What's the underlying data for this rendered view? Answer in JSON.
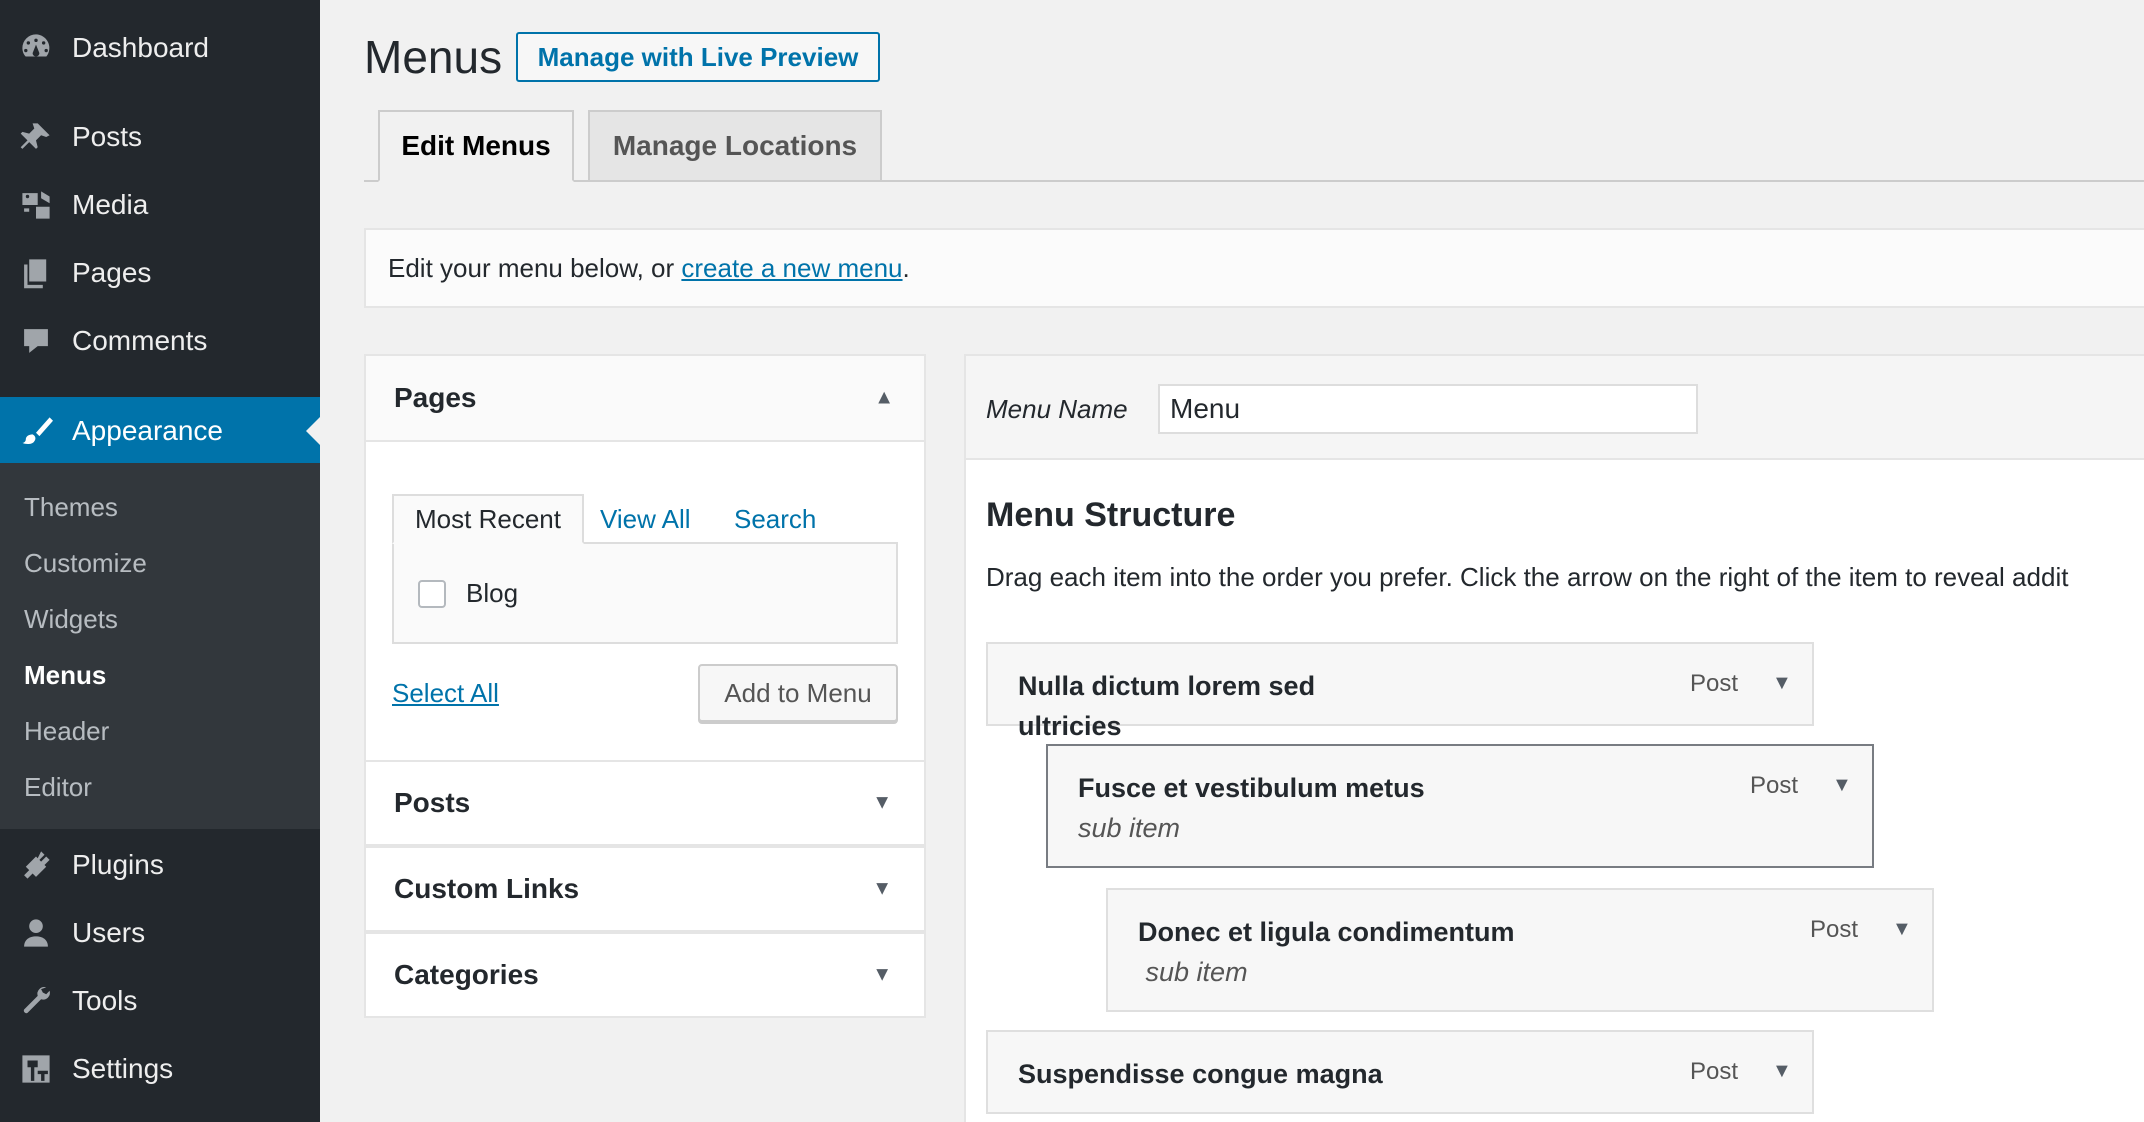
{
  "sidebar": {
    "items": [
      {
        "label": "Dashboard",
        "icon": "dashboard-icon"
      },
      {
        "label": "Posts",
        "icon": "pin-icon"
      },
      {
        "label": "Media",
        "icon": "media-icon"
      },
      {
        "label": "Pages",
        "icon": "pages-icon"
      },
      {
        "label": "Comments",
        "icon": "comment-icon"
      },
      {
        "label": "Appearance",
        "icon": "paintbrush-icon"
      },
      {
        "label": "Plugins",
        "icon": "plugin-icon"
      },
      {
        "label": "Users",
        "icon": "user-icon"
      },
      {
        "label": "Tools",
        "icon": "wrench-icon"
      },
      {
        "label": "Settings",
        "icon": "settings-icon"
      }
    ],
    "submenu": [
      "Themes",
      "Customize",
      "Widgets",
      "Menus",
      "Header",
      "Editor"
    ],
    "active_item": "Appearance",
    "current_submenu": "Menus"
  },
  "header": {
    "title": "Menus",
    "live_preview_label": "Manage with Live Preview"
  },
  "tabs": {
    "edit": "Edit Menus",
    "manage": "Manage Locations"
  },
  "notice": {
    "prefix": "Edit your menu below, or ",
    "link": "create a new menu",
    "suffix": "."
  },
  "left": {
    "pages_title": "Pages",
    "inner_tabs": {
      "recent": "Most Recent",
      "view_all": "View All",
      "search": "Search"
    },
    "page_options": [
      {
        "label": "Blog",
        "checked": false
      }
    ],
    "select_all": "Select All",
    "add_button": "Add to Menu",
    "sections": [
      "Posts",
      "Custom Links",
      "Categories"
    ]
  },
  "right": {
    "menu_name_label": "Menu Name",
    "menu_name_value": "Menu",
    "structure_title": "Menu Structure",
    "structure_desc": "Drag each item into the order you prefer. Click the arrow on the right of the item to reveal addit",
    "items": [
      {
        "title": "Nulla dictum lorem sed ultricies",
        "sub": "",
        "type": "Post"
      },
      {
        "title": "Fusce et vestibulum metus",
        "sub": "sub item",
        "type": "Post"
      },
      {
        "title": "Donec et ligula condimentum",
        "sub": "sub item",
        "type": "Post"
      },
      {
        "title": "Suspendisse congue magna",
        "sub": "",
        "type": "Post"
      }
    ]
  },
  "colors": {
    "sidebar_bg": "#23282d",
    "submenu_bg": "#32373c",
    "accent": "#0073aa"
  }
}
